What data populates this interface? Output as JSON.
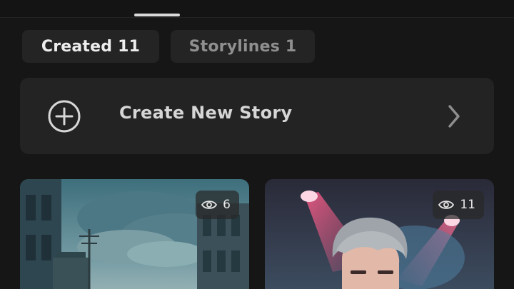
{
  "tabs": {
    "created": "Created 11",
    "storylines": "Storylines 1"
  },
  "create_card": {
    "label": "Create New Story",
    "icon": "plus-circle-icon",
    "chevron": "chevron-right-icon"
  },
  "stories": [
    {
      "views": "6",
      "icon": "eye-icon",
      "scene": "street-clouds"
    },
    {
      "views": "11",
      "icon": "eye-icon",
      "scene": "stage-portrait"
    }
  ],
  "colors": {
    "background": "#161616",
    "card": "#232323",
    "tab": "#242424",
    "text_primary": "#ededed",
    "text_secondary": "#8f8f8f"
  }
}
